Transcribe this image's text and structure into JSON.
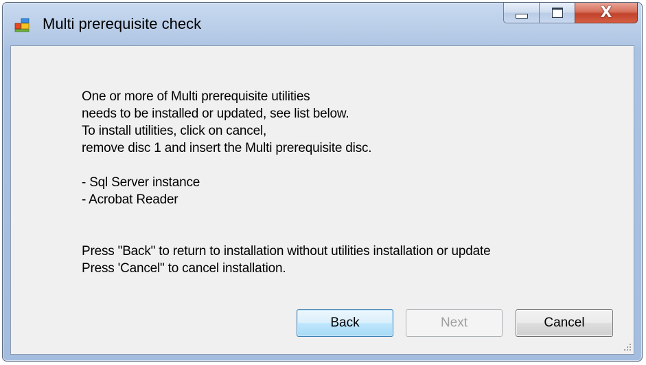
{
  "window": {
    "title": "Multi prerequisite check",
    "close_glyph": "X"
  },
  "message": {
    "lines": [
      "One or more of Multi prerequisite utilities",
      "needs to be installed or updated, see list below.",
      "To install utilities, click on cancel,",
      "remove disc 1 and insert the Multi prerequisite disc."
    ],
    "items": [
      "- Sql Server instance",
      "- Acrobat Reader"
    ],
    "instructions": [
      "Press \"Back\" to return to installation without utilities installation or update",
      "Press 'Cancel\" to cancel installation."
    ]
  },
  "buttons": {
    "back": "Back",
    "next": "Next",
    "cancel": "Cancel"
  },
  "icons": {
    "app": "app-icon",
    "minimize": "minimize-icon",
    "maximize": "maximize-icon",
    "close": "close-icon",
    "grip": "resize-grip-icon"
  }
}
